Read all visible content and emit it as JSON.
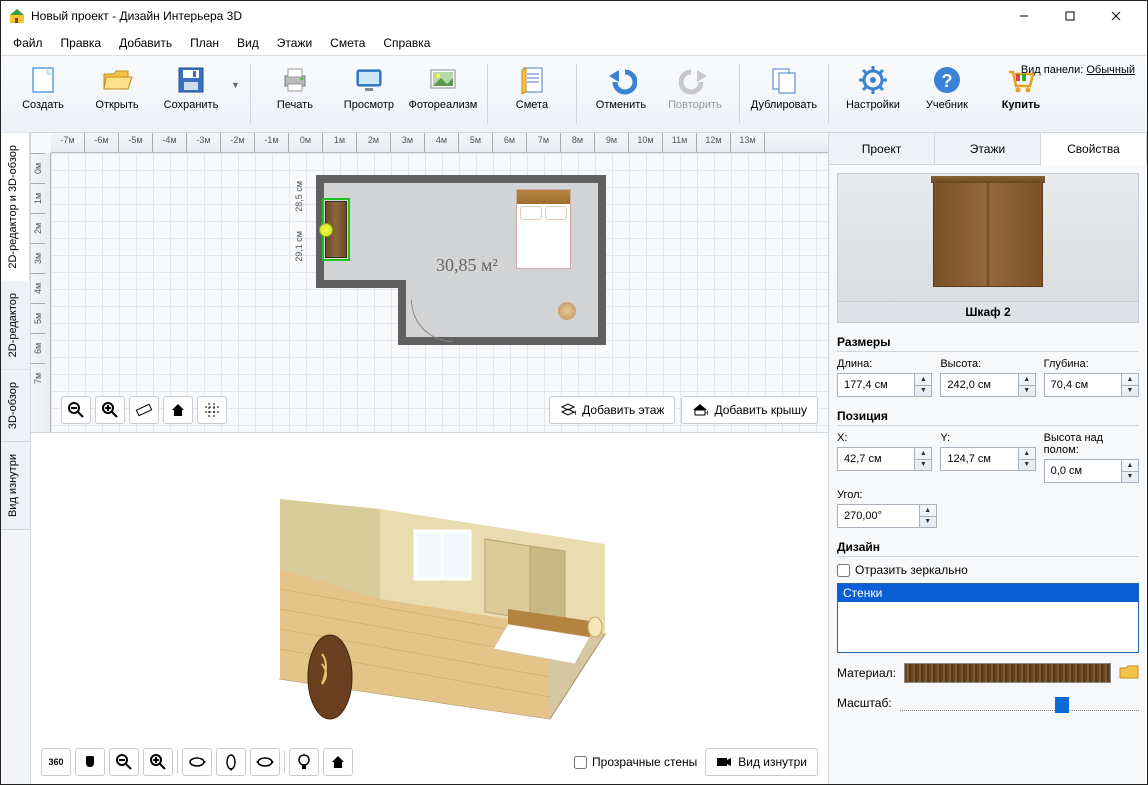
{
  "window": {
    "title": "Новый проект - Дизайн Интерьера 3D"
  },
  "menu": [
    "Файл",
    "Правка",
    "Добавить",
    "План",
    "Вид",
    "Этажи",
    "Смета",
    "Справка"
  ],
  "panel_mode": {
    "label": "Вид панели:",
    "value": "Обычный"
  },
  "toolbar": {
    "create": "Создать",
    "open": "Открыть",
    "save": "Сохранить",
    "print": "Печать",
    "preview": "Просмотр",
    "photoreal": "Фотореализм",
    "estimate": "Смета",
    "undo": "Отменить",
    "redo": "Повторить",
    "duplicate": "Дублировать",
    "settings": "Настройки",
    "tutorial": "Учебник",
    "buy": "Купить"
  },
  "left_tabs": [
    "2D-редактор и 3D-обзор",
    "2D-редактор",
    "3D-обзор",
    "Вид изнутри"
  ],
  "ruler_h": [
    "-7м",
    "-6м",
    "-5м",
    "-4м",
    "-3м",
    "-2м",
    "-1м",
    "0м",
    "1м",
    "2м",
    "3м",
    "4м",
    "5м",
    "6м",
    "7м",
    "8м",
    "9м",
    "10м",
    "11м",
    "12м",
    "13м"
  ],
  "ruler_v": [
    "0м",
    "1м",
    "2м",
    "3м",
    "4м",
    "5м",
    "6м",
    "7м"
  ],
  "plan": {
    "area_label": "30,85 м²",
    "dim1": "28,5 см",
    "dim2": "29,1 см"
  },
  "view2d_btns": {
    "add_floor": "Добавить этаж",
    "add_roof": "Добавить крышу"
  },
  "view3d_btns": {
    "transparent": "Прозрачные стены",
    "inside": "Вид изнутри"
  },
  "right_tabs": [
    "Проект",
    "Этажи",
    "Свойства"
  ],
  "props": {
    "object_name": "Шкаф 2",
    "dimensions_legend": "Размеры",
    "length_lbl": "Длина:",
    "length_val": "177,4 см",
    "height_lbl": "Высота:",
    "height_val": "242,0 см",
    "depth_lbl": "Глубина:",
    "depth_val": "70,4 см",
    "position_legend": "Позиция",
    "x_lbl": "X:",
    "x_val": "42,7 см",
    "y_lbl": "Y:",
    "y_val": "124,7 см",
    "floor_h_lbl": "Высота над полом:",
    "floor_h_val": "0,0 см",
    "angle_lbl": "Угол:",
    "angle_val": "270,00°",
    "design_legend": "Дизайн",
    "mirror_lbl": "Отразить зеркально",
    "list_item": "Стенки",
    "material_lbl": "Материал:",
    "scale_lbl": "Масштаб:"
  }
}
